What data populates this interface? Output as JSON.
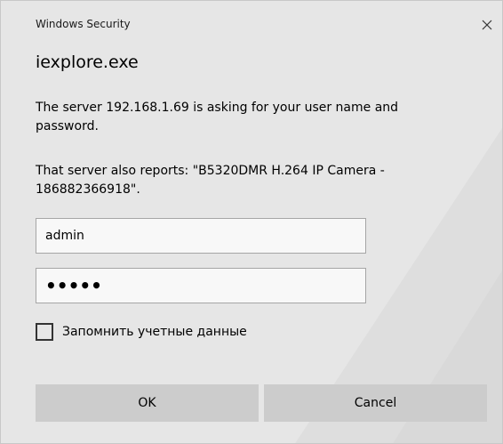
{
  "window": {
    "title": "Windows Security",
    "close_icon": "close-icon"
  },
  "app_name": "iexplore.exe",
  "messages": {
    "request": "The server 192.168.1.69 is asking for your user name and password.",
    "reports": "That server also reports: \"B5320DMR H.264 IP Camera - 186882366918\"."
  },
  "fields": {
    "username": "admin",
    "password": "•••••"
  },
  "remember": {
    "label": "Запомнить учетные данные",
    "checked": false
  },
  "buttons": {
    "ok": "OK",
    "cancel": "Cancel"
  },
  "colors": {
    "background": "#e6e6e6",
    "button": "#cccccc",
    "field": "#f8f8f8"
  }
}
